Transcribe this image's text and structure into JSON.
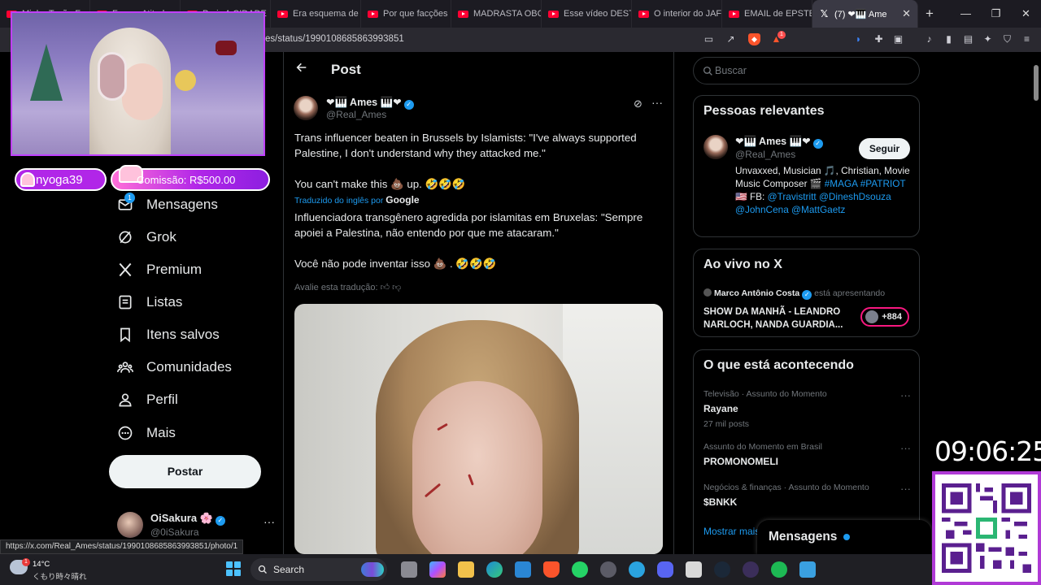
{
  "browser": {
    "tabs": [
      {
        "label": "Minha Tesão Fa",
        "type": "youtube"
      },
      {
        "label": "Forças Atitudes",
        "type": "youtube"
      },
      {
        "label": "Paris A CIDADE",
        "type": "youtube"
      },
      {
        "label": "Era esquema de",
        "type": "youtube"
      },
      {
        "label": "Por que facções",
        "type": "youtube"
      },
      {
        "label": "MADRASTA OBC",
        "type": "youtube"
      },
      {
        "label": "Esse vídeo DESTI",
        "type": "youtube"
      },
      {
        "label": "O interior do JAF",
        "type": "youtube"
      },
      {
        "label": "EMAIL de EPSTE",
        "type": "youtube"
      }
    ],
    "active_tab": {
      "label": "(7) ❤🎹 Ame",
      "close": "✕"
    },
    "new_tab": "+",
    "window_controls": [
      "—",
      "❐",
      "✕"
    ],
    "url": "es/status/1990108685863993851",
    "brave_badge": "1",
    "status_link": "https://x.com/Real_Ames/status/1990108685863993851/photo/1"
  },
  "nav": {
    "items": [
      {
        "label": "Mensagens",
        "icon": "mail-icon",
        "badge": "1"
      },
      {
        "label": "Grok",
        "icon": "grok-icon"
      },
      {
        "label": "Premium",
        "icon": "x-logo-icon"
      },
      {
        "label": "Listas",
        "icon": "list-icon"
      },
      {
        "label": "Itens salvos",
        "icon": "bookmark-icon"
      },
      {
        "label": "Comunidades",
        "icon": "communities-icon"
      },
      {
        "label": "Perfil",
        "icon": "profile-icon"
      },
      {
        "label": "Mais",
        "icon": "more-circle-icon"
      }
    ],
    "post_button": "Postar",
    "account": {
      "name": "OiSakura 🌸",
      "handle": "@0iSakura",
      "more": "···"
    }
  },
  "post": {
    "header_title": "Post",
    "author_name": "❤🎹 Ames 🎹❤",
    "author_handle": "@Real_Ames",
    "more": "···",
    "text_en_1": "Trans influencer beaten in Brussels by Islamists: \"I've always supported Palestine, I don't understand why they attacked me.\"",
    "text_en_2": "You can't  make this 💩 up.  🤣🤣🤣",
    "translated_label": "Traduzido do inglês por",
    "translated_brand": "Google",
    "text_pt_1": "Influenciadora transgênero agredida por islamitas em Bruxelas: \"Sempre apoiei a Palestina, não entendo por que me atacaram.\"",
    "text_pt_2": "Você não pode inventar isso 💩 . 🤣🤣🤣",
    "rate_translation": "Avalie esta tradução:"
  },
  "sidebar": {
    "search_placeholder": "Buscar",
    "relevant": {
      "title": "Pessoas relevantes",
      "name": "❤🎹 Ames 🎹❤",
      "handle": "@Real_Ames",
      "follow": "Seguir",
      "bio_text": "Unvaxxed, Musician 🎵, Christian, Movie Music Composer 🎬 ",
      "bio_tag1": "#MAGA",
      "bio_tag2": "#PATRIOT",
      "bio_fb": " 🇺🇸 FB: ",
      "bio_link1": "@Travistritt",
      "bio_link2": "@DineshDsouza",
      "bio_link3": "@JohnCena",
      "bio_link4": "@MattGaetz"
    },
    "live": {
      "title": "Ao vivo no X",
      "host": "Marco Antônio Costa",
      "host_suffix": "está apresentando",
      "show": "SHOW DA MANHÃ - LEANDRO NARLOCH, NANDA GUARDIA...",
      "listeners": "+884"
    },
    "trending": {
      "title": "O que está acontecendo",
      "items": [
        {
          "context": "Televisão · Assunto do Momento",
          "topic": "Rayane",
          "count": "27 mil posts"
        },
        {
          "context": "Assunto do Momento em Brasil",
          "topic": "PROMONOMELI",
          "count": ""
        },
        {
          "context": "Negócios & finanças · Assunto do Momento",
          "topic": "$BNKK",
          "count": ""
        }
      ],
      "show_more": "Mostrar mais"
    },
    "messages_drawer": "Mensagens"
  },
  "overlay": {
    "username": "nyoga39",
    "goal": "Comissão: R$500.00",
    "clock": "09:06:25"
  },
  "taskbar": {
    "temperature": "14°C",
    "weather_text": "くもり時々晴れ",
    "weather_badge": "1",
    "search": "Search"
  },
  "colors": {
    "accent": "#1d9bf0",
    "live_ring": "#f91880",
    "overlay_purple": "#b126e8"
  }
}
